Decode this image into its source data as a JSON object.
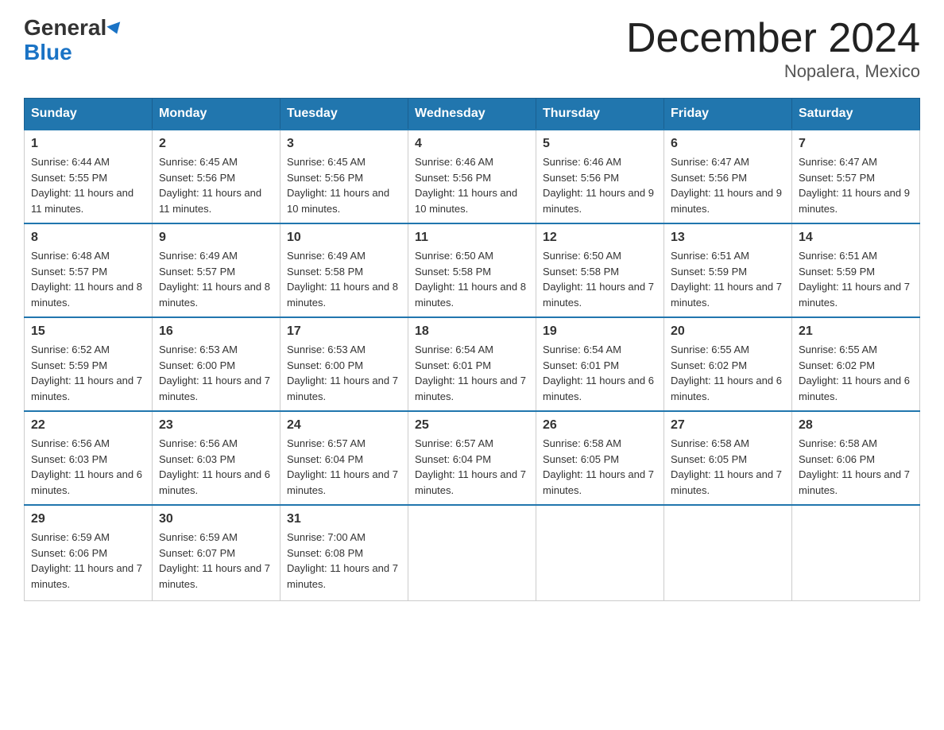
{
  "header": {
    "logo_line1": "General",
    "logo_line2": "Blue",
    "title": "December 2024",
    "subtitle": "Nopalera, Mexico"
  },
  "days_of_week": [
    "Sunday",
    "Monday",
    "Tuesday",
    "Wednesday",
    "Thursday",
    "Friday",
    "Saturday"
  ],
  "weeks": [
    [
      {
        "day": "1",
        "sunrise": "6:44 AM",
        "sunset": "5:55 PM",
        "daylight": "11 hours and 11 minutes."
      },
      {
        "day": "2",
        "sunrise": "6:45 AM",
        "sunset": "5:56 PM",
        "daylight": "11 hours and 11 minutes."
      },
      {
        "day": "3",
        "sunrise": "6:45 AM",
        "sunset": "5:56 PM",
        "daylight": "11 hours and 10 minutes."
      },
      {
        "day": "4",
        "sunrise": "6:46 AM",
        "sunset": "5:56 PM",
        "daylight": "11 hours and 10 minutes."
      },
      {
        "day": "5",
        "sunrise": "6:46 AM",
        "sunset": "5:56 PM",
        "daylight": "11 hours and 9 minutes."
      },
      {
        "day": "6",
        "sunrise": "6:47 AM",
        "sunset": "5:56 PM",
        "daylight": "11 hours and 9 minutes."
      },
      {
        "day": "7",
        "sunrise": "6:47 AM",
        "sunset": "5:57 PM",
        "daylight": "11 hours and 9 minutes."
      }
    ],
    [
      {
        "day": "8",
        "sunrise": "6:48 AM",
        "sunset": "5:57 PM",
        "daylight": "11 hours and 8 minutes."
      },
      {
        "day": "9",
        "sunrise": "6:49 AM",
        "sunset": "5:57 PM",
        "daylight": "11 hours and 8 minutes."
      },
      {
        "day": "10",
        "sunrise": "6:49 AM",
        "sunset": "5:58 PM",
        "daylight": "11 hours and 8 minutes."
      },
      {
        "day": "11",
        "sunrise": "6:50 AM",
        "sunset": "5:58 PM",
        "daylight": "11 hours and 8 minutes."
      },
      {
        "day": "12",
        "sunrise": "6:50 AM",
        "sunset": "5:58 PM",
        "daylight": "11 hours and 7 minutes."
      },
      {
        "day": "13",
        "sunrise": "6:51 AM",
        "sunset": "5:59 PM",
        "daylight": "11 hours and 7 minutes."
      },
      {
        "day": "14",
        "sunrise": "6:51 AM",
        "sunset": "5:59 PM",
        "daylight": "11 hours and 7 minutes."
      }
    ],
    [
      {
        "day": "15",
        "sunrise": "6:52 AM",
        "sunset": "5:59 PM",
        "daylight": "11 hours and 7 minutes."
      },
      {
        "day": "16",
        "sunrise": "6:53 AM",
        "sunset": "6:00 PM",
        "daylight": "11 hours and 7 minutes."
      },
      {
        "day": "17",
        "sunrise": "6:53 AM",
        "sunset": "6:00 PM",
        "daylight": "11 hours and 7 minutes."
      },
      {
        "day": "18",
        "sunrise": "6:54 AM",
        "sunset": "6:01 PM",
        "daylight": "11 hours and 7 minutes."
      },
      {
        "day": "19",
        "sunrise": "6:54 AM",
        "sunset": "6:01 PM",
        "daylight": "11 hours and 6 minutes."
      },
      {
        "day": "20",
        "sunrise": "6:55 AM",
        "sunset": "6:02 PM",
        "daylight": "11 hours and 6 minutes."
      },
      {
        "day": "21",
        "sunrise": "6:55 AM",
        "sunset": "6:02 PM",
        "daylight": "11 hours and 6 minutes."
      }
    ],
    [
      {
        "day": "22",
        "sunrise": "6:56 AM",
        "sunset": "6:03 PM",
        "daylight": "11 hours and 6 minutes."
      },
      {
        "day": "23",
        "sunrise": "6:56 AM",
        "sunset": "6:03 PM",
        "daylight": "11 hours and 6 minutes."
      },
      {
        "day": "24",
        "sunrise": "6:57 AM",
        "sunset": "6:04 PM",
        "daylight": "11 hours and 7 minutes."
      },
      {
        "day": "25",
        "sunrise": "6:57 AM",
        "sunset": "6:04 PM",
        "daylight": "11 hours and 7 minutes."
      },
      {
        "day": "26",
        "sunrise": "6:58 AM",
        "sunset": "6:05 PM",
        "daylight": "11 hours and 7 minutes."
      },
      {
        "day": "27",
        "sunrise": "6:58 AM",
        "sunset": "6:05 PM",
        "daylight": "11 hours and 7 minutes."
      },
      {
        "day": "28",
        "sunrise": "6:58 AM",
        "sunset": "6:06 PM",
        "daylight": "11 hours and 7 minutes."
      }
    ],
    [
      {
        "day": "29",
        "sunrise": "6:59 AM",
        "sunset": "6:06 PM",
        "daylight": "11 hours and 7 minutes."
      },
      {
        "day": "30",
        "sunrise": "6:59 AM",
        "sunset": "6:07 PM",
        "daylight": "11 hours and 7 minutes."
      },
      {
        "day": "31",
        "sunrise": "7:00 AM",
        "sunset": "6:08 PM",
        "daylight": "11 hours and 7 minutes."
      },
      {
        "day": "",
        "sunrise": "",
        "sunset": "",
        "daylight": ""
      },
      {
        "day": "",
        "sunrise": "",
        "sunset": "",
        "daylight": ""
      },
      {
        "day": "",
        "sunrise": "",
        "sunset": "",
        "daylight": ""
      },
      {
        "day": "",
        "sunrise": "",
        "sunset": "",
        "daylight": ""
      }
    ]
  ]
}
